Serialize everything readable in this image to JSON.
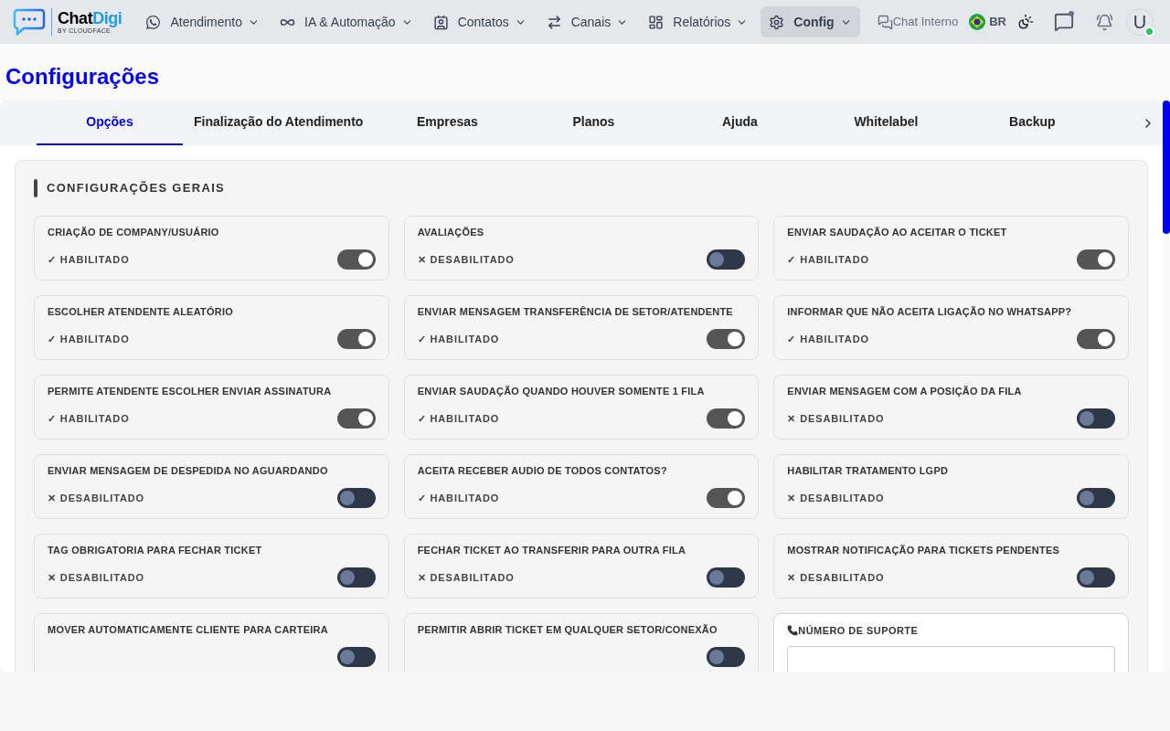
{
  "logo": {
    "word1": "Chat",
    "word2": "Digi",
    "tagline": "BY CLOUDFACE"
  },
  "nav": [
    {
      "label": "Atendimento",
      "selected": false
    },
    {
      "label": "IA & Automação",
      "selected": false
    },
    {
      "label": "Contatos",
      "selected": false
    },
    {
      "label": "Canais",
      "selected": false
    },
    {
      "label": "Relatórios",
      "selected": false
    },
    {
      "label": "Config",
      "selected": true
    }
  ],
  "chat_interno": "Chat Interno",
  "language": "BR",
  "user": {
    "initial": "U",
    "online": true
  },
  "page_title": "Configurações",
  "tabs": [
    {
      "label": "Opções",
      "selected": true
    },
    {
      "label": "Finalização do Atendimento",
      "selected": false
    },
    {
      "label": "Empresas",
      "selected": false
    },
    {
      "label": "Planos",
      "selected": false
    },
    {
      "label": "Ajuda",
      "selected": false
    },
    {
      "label": "Whitelabel",
      "selected": false
    },
    {
      "label": "Backup",
      "selected": false
    }
  ],
  "section_title": "CONFIGURAÇÕES GERAIS",
  "settings": [
    {
      "kind": "toggle",
      "title": "CRIAÇÃO DE COMPANY/USUÁRIO",
      "status": "✓ HABILITADO",
      "on": true
    },
    {
      "kind": "toggle",
      "title": "AVALIAÇÕES",
      "status": "✕ DESABILITADO",
      "on": false
    },
    {
      "kind": "toggle",
      "title": "ENVIAR SAUDAÇÃO AO ACEITAR O TICKET",
      "status": "✓ HABILITADO",
      "on": true
    },
    {
      "kind": "toggle",
      "title": "ESCOLHER ATENDENTE ALEATÓRIO",
      "status": "✓ HABILITADO",
      "on": true
    },
    {
      "kind": "toggle",
      "title": "ENVIAR MENSAGEM TRANSFERÊNCIA DE SETOR/ATENDENTE",
      "status": "✓ HABILITADO",
      "on": true
    },
    {
      "kind": "toggle",
      "title": "INFORMAR QUE NÃO ACEITA LIGAÇÃO NO WHATSAPP?",
      "status": "✓ HABILITADO",
      "on": true
    },
    {
      "kind": "toggle",
      "title": "PERMITE ATENDENTE ESCOLHER ENVIAR ASSINATURA",
      "status": "✓ HABILITADO",
      "on": true
    },
    {
      "kind": "toggle",
      "title": "ENVIAR SAUDAÇÃO QUANDO HOUVER SOMENTE 1 FILA",
      "status": "✓ HABILITADO",
      "on": true
    },
    {
      "kind": "toggle",
      "title": "ENVIAR MENSAGEM COM A POSIÇÃO DA FILA",
      "status": "✕ DESABILITADO",
      "on": false
    },
    {
      "kind": "toggle",
      "title": "ENVIAR MENSAGEM DE DESPEDIDA NO AGUARDANDO",
      "status": "✕ DESABILITADO",
      "on": false
    },
    {
      "kind": "toggle",
      "title": "ACEITA RECEBER AUDIO DE TODOS CONTATOS?",
      "status": "✓ HABILITADO",
      "on": true
    },
    {
      "kind": "toggle",
      "title": "HABILITAR TRATAMENTO LGPD",
      "status": "✕ DESABILITADO",
      "on": false
    },
    {
      "kind": "toggle",
      "title": "TAG OBRIGATORIA PARA FECHAR TICKET",
      "status": "✕ DESABILITADO",
      "on": false
    },
    {
      "kind": "toggle",
      "title": "FECHAR TICKET AO TRANSFERIR PARA OUTRA FILA",
      "status": "✕ DESABILITADO",
      "on": false
    },
    {
      "kind": "toggle",
      "title": "MOSTRAR NOTIFICAÇÃO PARA TICKETS PENDENTES",
      "status": "✕ DESABILITADO",
      "on": false
    },
    {
      "kind": "toggle",
      "title": "MOVER AUTOMATICAMENTE CLIENTE PARA CARTEIRA",
      "on": false
    },
    {
      "kind": "toggle",
      "title": "PERMITIR ABRIR TICKET EM QUALQUER SETOR/CONEXÃO",
      "on": false
    },
    {
      "kind": "input",
      "title": "NÚMERO DE SUPORTE"
    }
  ]
}
